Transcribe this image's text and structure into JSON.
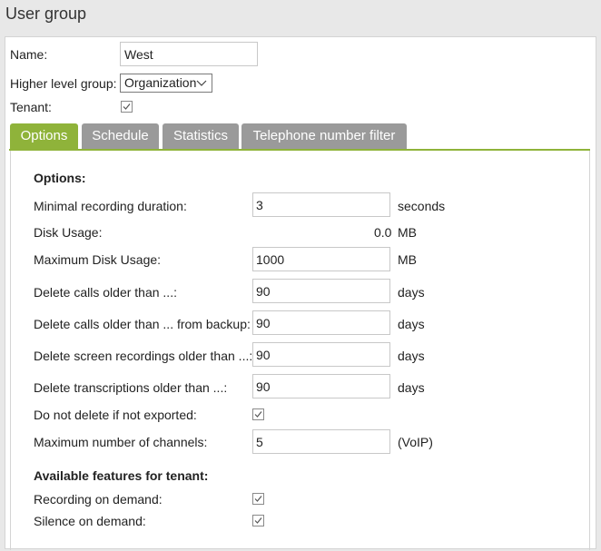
{
  "page": {
    "title": "User group"
  },
  "general": {
    "name_label": "Name:",
    "name_value": "West",
    "higher_group_label": "Higher level group:",
    "higher_group_value": "Organization",
    "tenant_label": "Tenant:",
    "tenant_checked": true
  },
  "tabs": [
    {
      "label": "Options",
      "active": true
    },
    {
      "label": "Schedule",
      "active": false
    },
    {
      "label": "Statistics",
      "active": false
    },
    {
      "label": "Telephone number filter",
      "active": false
    }
  ],
  "options": {
    "section_title": "Options:",
    "min_duration": {
      "label": "Minimal recording duration:",
      "value": "3",
      "unit": "seconds"
    },
    "disk_usage": {
      "label": "Disk Usage:",
      "value": "0.0",
      "unit": "MB"
    },
    "max_disk": {
      "label": "Maximum Disk Usage:",
      "value": "1000",
      "unit": "MB"
    },
    "delete_calls": {
      "label": "Delete calls older than ...:",
      "value": "90",
      "unit": "days"
    },
    "delete_calls_backup": {
      "label": "Delete calls older than ... from backup:",
      "value": "90",
      "unit": "days"
    },
    "delete_screen": {
      "label": "Delete screen recordings older than ...:",
      "value": "90",
      "unit": "days"
    },
    "delete_transcriptions": {
      "label": "Delete transcriptions older than ...:",
      "value": "90",
      "unit": "days"
    },
    "do_not_delete": {
      "label": "Do not delete if not exported:",
      "checked": true
    },
    "max_channels": {
      "label": "Maximum number of channels:",
      "value": "5",
      "unit": "(VoIP)"
    }
  },
  "features": {
    "section_title": "Available features for tenant:",
    "recording_on_demand": {
      "label": "Recording on demand:",
      "checked": true
    },
    "silence_on_demand": {
      "label": "Silence on demand:",
      "checked": true
    }
  },
  "colors": {
    "accent": "#8fb33a",
    "tab_inactive": "#9a9a9a"
  },
  "icons": {
    "checkbox_mark": "check-icon",
    "select_arrow": "chevron-down-icon"
  }
}
